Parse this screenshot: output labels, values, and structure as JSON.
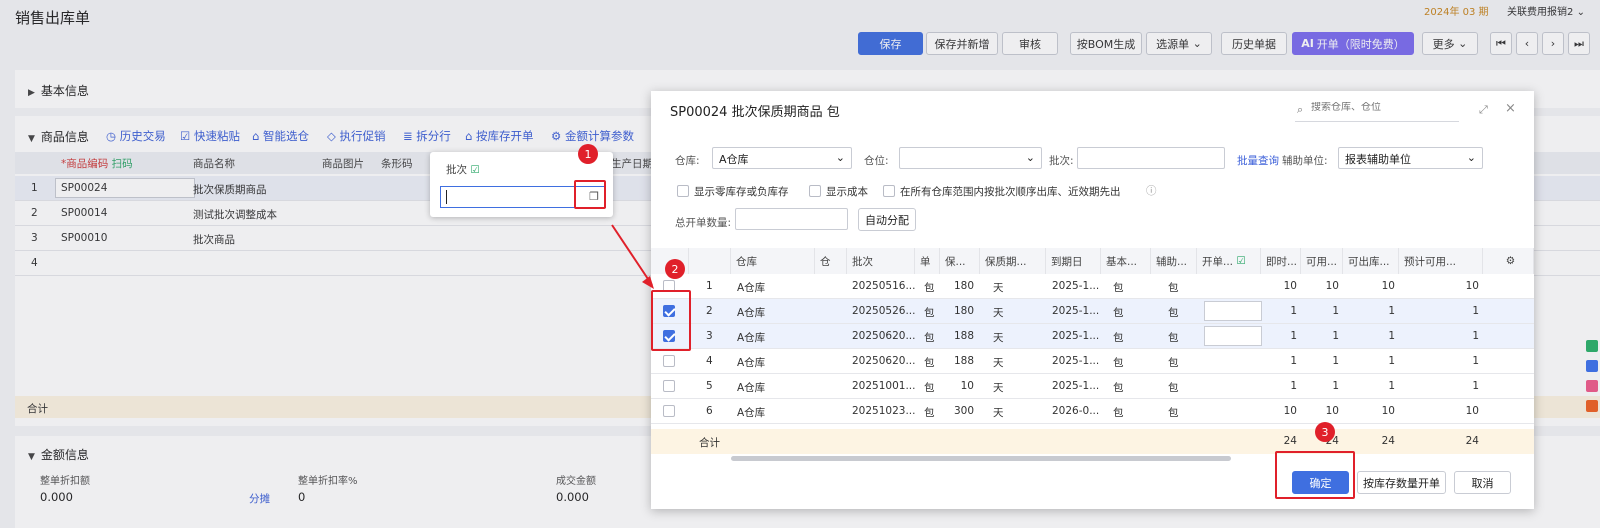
{
  "app": {
    "title": "销售出库单",
    "period": "2024年 03 期",
    "account": "关联费用报销2"
  },
  "toolbar": {
    "save": "保存",
    "save_new": "保存并新增",
    "audit": "审核",
    "bom": "按BOM生成",
    "select_source": "选源单",
    "history": "历史单据",
    "open_order": "开单（限时免费）",
    "more": "更多"
  },
  "sections": {
    "basic": "基本信息",
    "goods": "商品信息",
    "amount": "金额信息"
  },
  "goods_tools": [
    "历史交易",
    "快速粘贴",
    "智能选仓",
    "执行促销",
    "拆分行",
    "按库存开单",
    "金额计算参数"
  ],
  "goods_table": {
    "headers": [
      "*商品编码",
      "扫码",
      "商品名称",
      "商品图片",
      "条形码",
      "生产日期"
    ],
    "rows": [
      {
        "no": "1",
        "code": "SP00024",
        "name": "批次保质期商品"
      },
      {
        "no": "2",
        "code": "SP00014",
        "name": "测试批次调整成本"
      },
      {
        "no": "3",
        "code": "SP00010",
        "name": "批次商品"
      },
      {
        "no": "4",
        "code": "",
        "name": ""
      }
    ],
    "sum_label": "合计"
  },
  "amount": {
    "discount_label": "整单折扣额",
    "discount_value": "0.000",
    "split": "分摊",
    "rate_label": "整单折扣率%",
    "rate_value": "0",
    "deal_label": "成交金额",
    "deal_value": "0.000"
  },
  "batch_popup": {
    "label": "批次",
    "value": ""
  },
  "modal": {
    "title": "SP00024 批次保质期商品 包",
    "search_placeholder": "搜索仓库、仓位",
    "warehouse_label": "仓库:",
    "warehouse_value": "A仓库",
    "location_label": "仓位:",
    "location_value": "",
    "batch_label": "批次:",
    "batch_value": "",
    "batch_query": "批量查询",
    "aux_label": "辅助单位:",
    "aux_value": "报表辅助单位",
    "opt_zero": "显示零库存或负库存",
    "opt_cost": "显示成本",
    "opt_all": "在所有仓库范围内按批次顺序出库、近效期先出",
    "total_label": "总开单数量:",
    "auto_alloc": "自动分配",
    "headers": [
      "仓库",
      "仓",
      "批次",
      "单",
      "保...",
      "保质期...",
      "到期日",
      "基本...",
      "辅助...",
      "开单...",
      "即时...",
      "可用...",
      "可出库...",
      "预计可用..."
    ],
    "rows": [
      {
        "no": "1",
        "wh": "A仓库",
        "batch": "20250516...",
        "unit": "包",
        "shelf": "180",
        "sunit": "天",
        "expire": "2025-1...",
        "base": "包",
        "aux": "包",
        "checked": false,
        "now": "10",
        "avail": "10",
        "out": "10",
        "est": "10"
      },
      {
        "no": "2",
        "wh": "A仓库",
        "batch": "20250526...",
        "unit": "包",
        "shelf": "180",
        "sunit": "天",
        "expire": "2025-1...",
        "base": "包",
        "aux": "包",
        "checked": true,
        "now": "1",
        "avail": "1",
        "out": "1",
        "est": "1"
      },
      {
        "no": "3",
        "wh": "A仓库",
        "batch": "20250620...",
        "unit": "包",
        "shelf": "188",
        "sunit": "天",
        "expire": "2025-1...",
        "base": "包",
        "aux": "包",
        "checked": true,
        "now": "1",
        "avail": "1",
        "out": "1",
        "est": "1"
      },
      {
        "no": "4",
        "wh": "A仓库",
        "batch": "20250620...",
        "unit": "包",
        "shelf": "188",
        "sunit": "天",
        "expire": "2025-1...",
        "base": "包",
        "aux": "包",
        "checked": false,
        "now": "1",
        "avail": "1",
        "out": "1",
        "est": "1"
      },
      {
        "no": "5",
        "wh": "A仓库",
        "batch": "20251001...",
        "unit": "包",
        "shelf": "10",
        "sunit": "天",
        "expire": "2025-1...",
        "base": "包",
        "aux": "包",
        "checked": false,
        "now": "1",
        "avail": "1",
        "out": "1",
        "est": "1"
      },
      {
        "no": "6",
        "wh": "A仓库",
        "batch": "20251023...",
        "unit": "包",
        "shelf": "300",
        "sunit": "天",
        "expire": "2026-0...",
        "base": "包",
        "aux": "包",
        "checked": false,
        "now": "10",
        "avail": "10",
        "out": "10",
        "est": "10"
      }
    ],
    "sum": {
      "label": "合计",
      "now": "24",
      "avail": "24",
      "out": "24",
      "est": "24"
    },
    "confirm": "确定",
    "by_stock": "按库存数量开单",
    "cancel": "取消"
  },
  "badges": [
    "1",
    "2",
    "3"
  ],
  "colors": {
    "primary": "#3f6fe0",
    "highlight": "#e0202a",
    "sum_bg": "#fdf4e3",
    "accent_purple": "#7c6cf0"
  }
}
